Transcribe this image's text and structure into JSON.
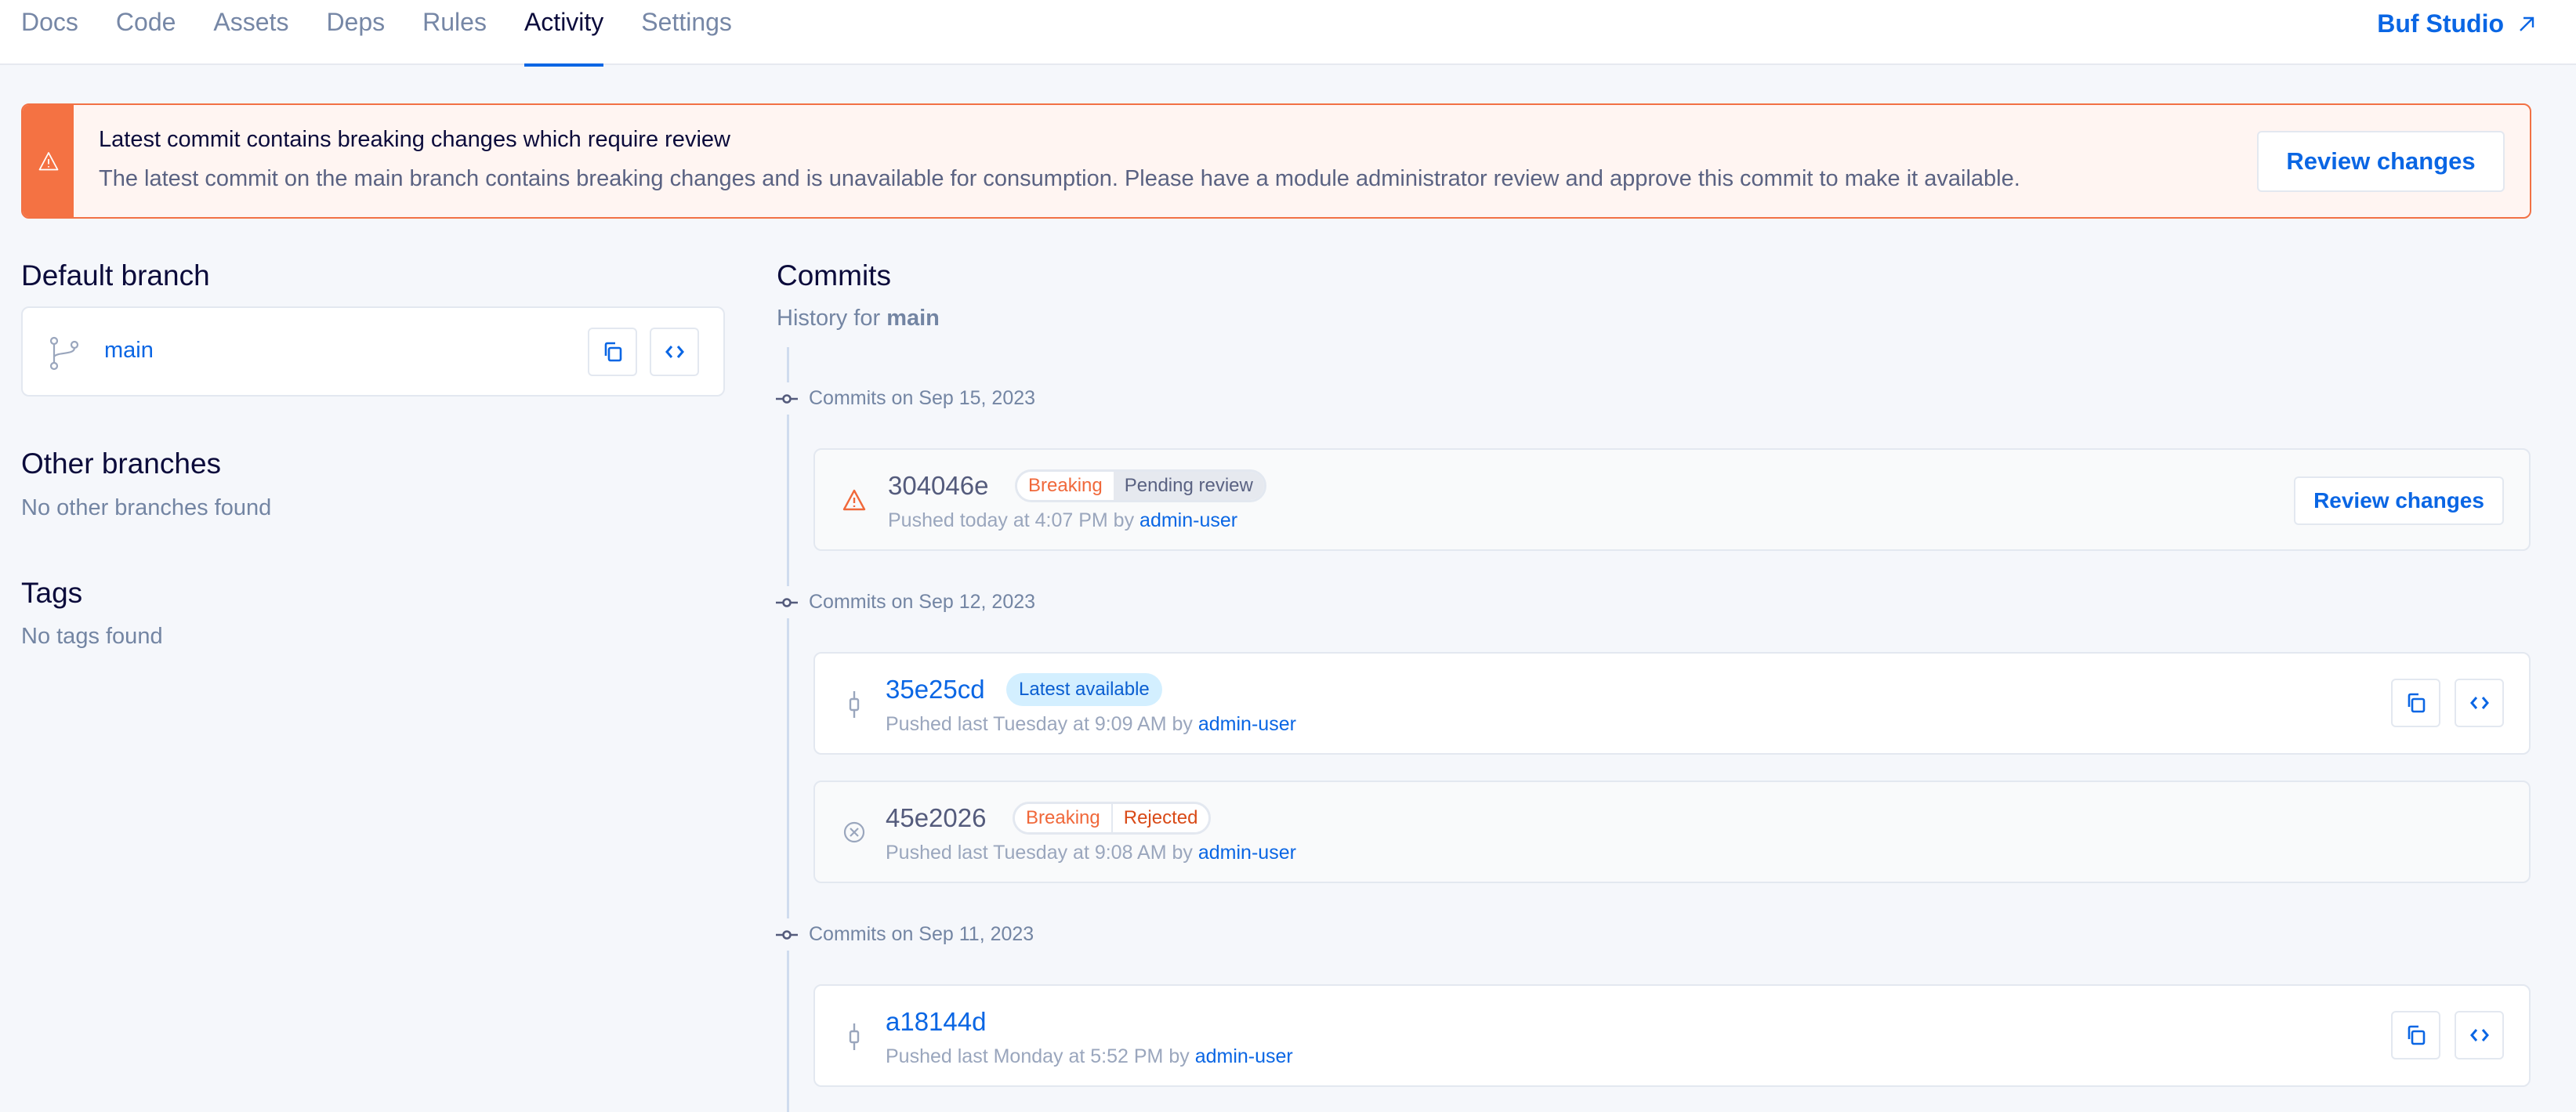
{
  "header": {
    "tabs": [
      {
        "label": "Docs",
        "active": false
      },
      {
        "label": "Code",
        "active": false
      },
      {
        "label": "Assets",
        "active": false
      },
      {
        "label": "Deps",
        "active": false
      },
      {
        "label": "Rules",
        "active": false
      },
      {
        "label": "Activity",
        "active": true
      },
      {
        "label": "Settings",
        "active": false
      }
    ],
    "studio_link": {
      "label": "Buf Studio",
      "icon": "external-link-arrow-icon"
    }
  },
  "banner": {
    "icon": "warning-icon",
    "title": "Latest commit contains breaking changes which require review",
    "body": "The latest commit on the main branch contains breaking changes and is unavailable for consumption. Please have a module administrator review and approve this commit to make it available.",
    "button_label": "Review changes",
    "colors": {
      "accent": "#f47243",
      "background": "#fff5f2"
    }
  },
  "left": {
    "default_branch": {
      "title": "Default branch",
      "branch_name": "main",
      "icon": "git-branch-icon",
      "actions": [
        "copy-icon",
        "code-icon"
      ]
    },
    "other_branches": {
      "title": "Other branches",
      "empty_text": "No other branches found"
    },
    "tags": {
      "title": "Tags",
      "empty_text": "No tags found"
    }
  },
  "commits": {
    "title": "Commits",
    "subtitle_prefix": "History for",
    "subtitle_branch": "main",
    "groups": [
      {
        "date_label": "Commits on Sep 15, 2023",
        "items": [
          {
            "hash": "304046e",
            "status_icon": "warning-icon",
            "badges": [
              "Breaking",
              "Pending review"
            ],
            "meta_prefix": "Pushed today at 4:07 PM by",
            "author": "admin-user",
            "action_label": "Review changes"
          }
        ]
      },
      {
        "date_label": "Commits on Sep 12, 2023",
        "items": [
          {
            "hash": "35e25cd",
            "status_icon": "commit-icon",
            "badges": [
              "Latest available"
            ],
            "meta_prefix": "Pushed last Tuesday at 9:09 AM by",
            "author": "admin-user",
            "actions": [
              "copy-icon",
              "code-icon"
            ]
          },
          {
            "hash": "45e2026",
            "status_icon": "rejected-circle-x-icon",
            "badges": [
              "Breaking",
              "Rejected"
            ],
            "meta_prefix": "Pushed last Tuesday at 9:08 AM by",
            "author": "admin-user"
          }
        ]
      },
      {
        "date_label": "Commits on Sep 11, 2023",
        "items": [
          {
            "hash": "a18144d",
            "status_icon": "commit-icon",
            "badges": [],
            "meta_prefix": "Pushed last Monday at 5:52 PM by",
            "author": "admin-user",
            "actions": [
              "copy-icon",
              "code-icon"
            ]
          }
        ]
      }
    ]
  },
  "colors": {
    "link": "#0a66e4",
    "breaking": "#f0683a",
    "rejected": "#d94a17",
    "latest_badge_bg": "#d3efff"
  }
}
